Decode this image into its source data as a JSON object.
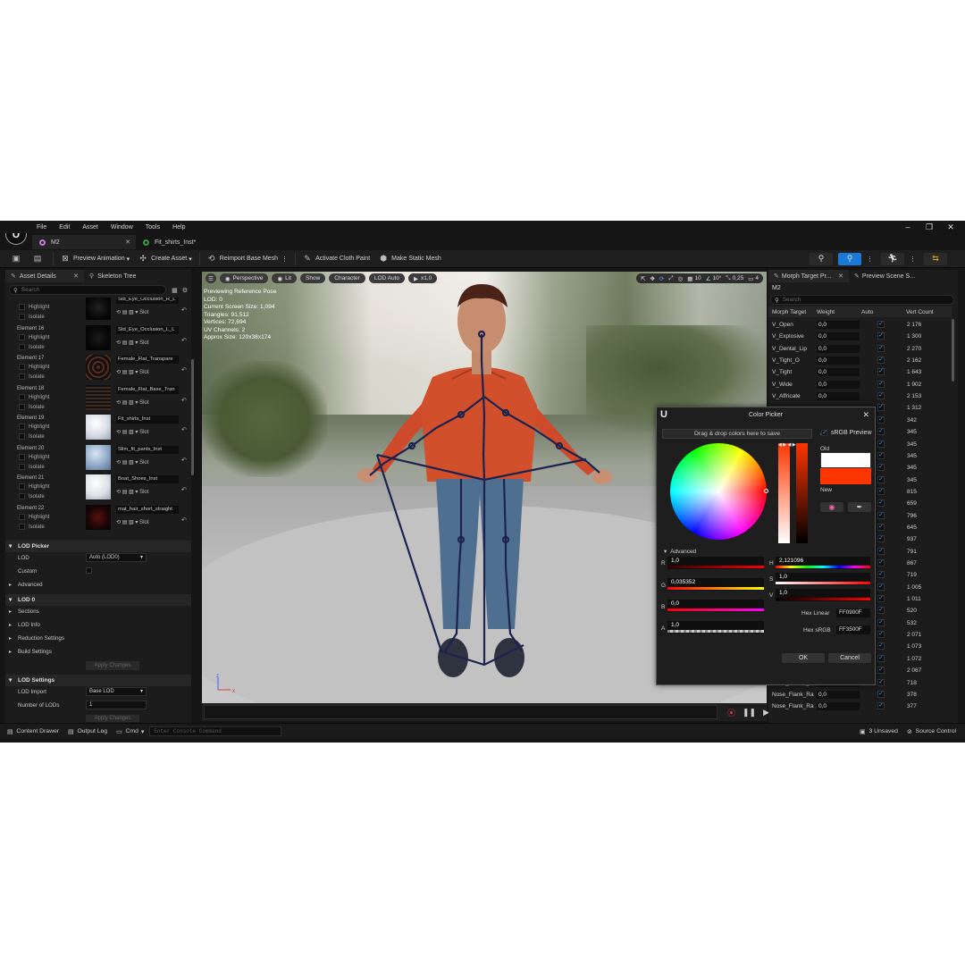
{
  "app": {
    "logo": "U"
  },
  "menu": [
    "File",
    "Edit",
    "Asset",
    "Window",
    "Tools",
    "Help"
  ],
  "tabs": [
    {
      "label": "M2",
      "active": true
    },
    {
      "label": "Fit_shirts_Inst*",
      "active": false
    }
  ],
  "toolbar": {
    "preview_animation": "Preview Animation",
    "create_asset": "Create Asset",
    "reimport": "Reimport Base Mesh",
    "cloth_paint": "Activate Cloth Paint",
    "static_mesh": "Make Static Mesh"
  },
  "left_panel": {
    "tab_details": "Asset Details",
    "tab_skeleton": "Skeleton Tree",
    "search_placeholder": "Search",
    "highlight": "Highlight",
    "isolate": "Isolate",
    "slot": "Slot",
    "elements": [
      {
        "label": "",
        "material": "Std_Eye_Occlusion_R_L"
      },
      {
        "label": "Element 16",
        "material": "Std_Eye_Occlusion_L_L"
      },
      {
        "label": "Element 17",
        "material": "Female_Flat_Transpare"
      },
      {
        "label": "Element 18",
        "material": "Female_Flat_Base_Tran"
      },
      {
        "label": "Element 19",
        "material": "Fit_shirts_Inst"
      },
      {
        "label": "Element 20",
        "material": "Slim_fit_pants_Inst"
      },
      {
        "label": "Element 21",
        "material": "Boat_Shoes_Inst"
      },
      {
        "label": "Element 22",
        "material": "mat_hair_short_straight"
      }
    ],
    "lod_picker": "LOD Picker",
    "lod_label": "LOD",
    "lod_value": "Auto (LOD0)",
    "custom_label": "Custom",
    "advanced": "Advanced",
    "lod0": "LOD 0",
    "sections": "Sections",
    "lod_info": "LOD Info",
    "reduction": "Reduction Settings",
    "build": "Build Settings",
    "apply": "Apply Changes",
    "lod_settings": "LOD Settings",
    "lod_import": "LOD Import",
    "lod_import_value": "Base LOD",
    "num_lods": "Number of LODs",
    "num_lods_value": "1",
    "apply2": "Apply Changes"
  },
  "viewport": {
    "perspective": "Perspective",
    "lit": "Lit",
    "show": "Show",
    "character": "Character",
    "lod": "LOD Auto",
    "speed": "x1,0",
    "grid": "10",
    "angle": "10°",
    "scale": "0,25",
    "cams": "4",
    "stats": [
      "Previewing Reference Pose",
      "LOD: 0",
      "Current Screen Size: 1,094",
      "Triangles: 91,512",
      "Vertices: 72,694",
      "UV Channels: 2",
      "Approx Size: 120x38x174"
    ]
  },
  "right_panel": {
    "tab_morph": "Morph Target Pr...",
    "tab_scene": "Preview Scene S...",
    "mesh_name": "M2",
    "search_placeholder": "Search",
    "headers": [
      "Morph Target",
      "Weight",
      "Auto",
      "Vert Count"
    ],
    "rows": [
      {
        "name": "V_Open",
        "weight": "0,0",
        "vc": "2 176"
      },
      {
        "name": "V_Explosive",
        "weight": "0,0",
        "vc": "1 300"
      },
      {
        "name": "V_Dental_Lip",
        "weight": "0,0",
        "vc": "2 270"
      },
      {
        "name": "V_Tight_O",
        "weight": "0,0",
        "vc": "2 162"
      },
      {
        "name": "V_Tight",
        "weight": "0,0",
        "vc": "1 643"
      },
      {
        "name": "V_Wide",
        "weight": "0,0",
        "vc": "1 902"
      },
      {
        "name": "V_Affricate",
        "weight": "0,0",
        "vc": "2 153"
      },
      {
        "name": "",
        "weight": "",
        "vc": "1 312"
      },
      {
        "name": "",
        "weight": "",
        "vc": "342"
      },
      {
        "name": "",
        "weight": "",
        "vc": "345"
      },
      {
        "name": "",
        "weight": "",
        "vc": "345"
      },
      {
        "name": "",
        "weight": "",
        "vc": "345"
      },
      {
        "name": "",
        "weight": "",
        "vc": "345"
      },
      {
        "name": "",
        "weight": "",
        "vc": "345"
      },
      {
        "name": "",
        "weight": "",
        "vc": "815"
      },
      {
        "name": "",
        "weight": "",
        "vc": "659"
      },
      {
        "name": "",
        "weight": "",
        "vc": "796"
      },
      {
        "name": "",
        "weight": "",
        "vc": "645"
      },
      {
        "name": "",
        "weight": "",
        "vc": "937"
      },
      {
        "name": "",
        "weight": "",
        "vc": "791"
      },
      {
        "name": "",
        "weight": "",
        "vc": "867"
      },
      {
        "name": "",
        "weight": "",
        "vc": "719"
      },
      {
        "name": "",
        "weight": "",
        "vc": "1 005"
      },
      {
        "name": "",
        "weight": "",
        "vc": "1 011"
      },
      {
        "name": "",
        "weight": "",
        "vc": "520"
      },
      {
        "name": "",
        "weight": "",
        "vc": "532"
      },
      {
        "name": "",
        "weight": "",
        "vc": "2 071"
      },
      {
        "name": "",
        "weight": "",
        "vc": "1 073"
      },
      {
        "name": "",
        "weight": "",
        "vc": "1 072"
      },
      {
        "name": "Nose_Scratch",
        "weight": "0,0",
        "vc": "2 067"
      },
      {
        "name": "Nose_Flanks_R",
        "weight": "0,0",
        "vc": "718"
      },
      {
        "name": "Nose_Flank_Ra",
        "weight": "0,0",
        "vc": "378"
      },
      {
        "name": "Nose_Flank_Ra",
        "weight": "0,0",
        "vc": "377"
      }
    ]
  },
  "color_picker": {
    "title": "Color Picker",
    "drag_drop": "Drag & drop colors here to save",
    "srgb": "sRGB Preview",
    "old": "Old",
    "new": "New",
    "advanced": "Advanced",
    "r_label": "R",
    "r": "1,0",
    "g_label": "G",
    "g": "0,035352",
    "b_label": "B",
    "b": "0,0",
    "a_label": "A",
    "a": "1,0",
    "h_label": "H",
    "h": "2,121096",
    "s_label": "S",
    "s": "1,0",
    "v_label": "V",
    "v": "1,0",
    "hex_linear_label": "Hex Linear",
    "hex_linear": "FF0900F",
    "hex_srgb_label": "Hex sRGB",
    "hex_srgb": "FF3500F",
    "ok": "OK",
    "cancel": "Cancel",
    "colors": {
      "old": "#ffffff",
      "new": "#ff3500"
    }
  },
  "status_bar": {
    "content_drawer": "Content Drawer",
    "output_log": "Output Log",
    "cmd": "Cmd",
    "console_placeholder": "Enter Console Command",
    "unsaved": "3 Unsaved",
    "source_control": "Source Control"
  }
}
